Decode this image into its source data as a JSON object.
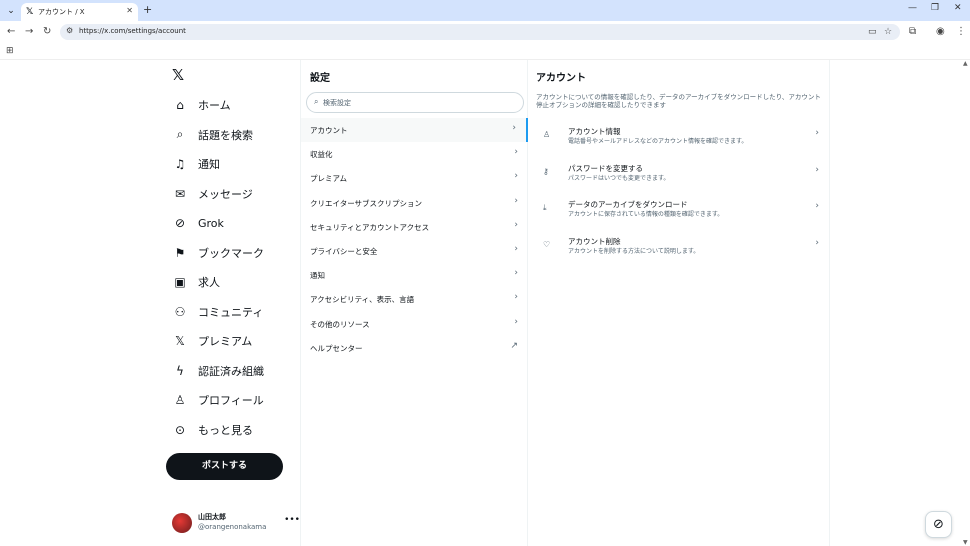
{
  "browser": {
    "tab_title": "アカウント / X",
    "url": "https://x.com/settings/account"
  },
  "leftnav": {
    "items": [
      {
        "label": "ホーム",
        "icon": "home-icon",
        "glyph": "⌂"
      },
      {
        "label": "話題を検索",
        "icon": "search-icon",
        "glyph": "⌕"
      },
      {
        "label": "通知",
        "icon": "bell-icon",
        "glyph": "♫"
      },
      {
        "label": "メッセージ",
        "icon": "envelope-icon",
        "glyph": "✉"
      },
      {
        "label": "Grok",
        "icon": "grok-icon",
        "glyph": "⊘"
      },
      {
        "label": "ブックマーク",
        "icon": "bookmark-icon",
        "glyph": "⚑"
      },
      {
        "label": "求人",
        "icon": "briefcase-icon",
        "glyph": "▣"
      },
      {
        "label": "コミュニティ",
        "icon": "community-icon",
        "glyph": "⚇"
      },
      {
        "label": "プレミアム",
        "icon": "x-icon",
        "glyph": "𝕏"
      },
      {
        "label": "認証済み組織",
        "icon": "lightning-icon",
        "glyph": "ϟ"
      },
      {
        "label": "プロフィール",
        "icon": "person-icon",
        "glyph": "♙"
      },
      {
        "label": "もっと見る",
        "icon": "more-circle-icon",
        "glyph": "⊙"
      }
    ],
    "post_label": "ポストする",
    "user_name": "山田太郎",
    "user_handle": "@orangenonakama"
  },
  "settings": {
    "title": "設定",
    "search_placeholder": "検索設定",
    "items": [
      {
        "label": "アカウント",
        "active": true,
        "glyph": "›"
      },
      {
        "label": "収益化",
        "glyph": "›"
      },
      {
        "label": "プレミアム",
        "glyph": "›"
      },
      {
        "label": "クリエイターサブスクリプション",
        "glyph": "›"
      },
      {
        "label": "セキュリティとアカウントアクセス",
        "glyph": "›"
      },
      {
        "label": "プライバシーと安全",
        "glyph": "›"
      },
      {
        "label": "通知",
        "glyph": "›"
      },
      {
        "label": "アクセシビリティ、表示、言語",
        "glyph": "›"
      },
      {
        "label": "その他のリソース",
        "glyph": "›"
      },
      {
        "label": "ヘルプセンター",
        "glyph": "↗"
      }
    ]
  },
  "account": {
    "title": "アカウント",
    "description": "アカウントについての情報を確認したり、データのアーカイブをダウンロードしたり、アカウント停止オプションの詳細を確認したりできます",
    "items": [
      {
        "label": "アカウント情報",
        "sub": "電話番号やメールアドレスなどのアカウント情報を確認できます。",
        "icon": "person-icon",
        "glyph": "♙"
      },
      {
        "label": "パスワードを変更する",
        "sub": "パスワードはいつでも変更できます。",
        "icon": "key-icon",
        "glyph": "⚷"
      },
      {
        "label": "データのアーカイブをダウンロード",
        "sub": "アカウントに保存されている情報の種類を確認できます。",
        "icon": "download-icon",
        "glyph": "⤓"
      },
      {
        "label": "アカウント削除",
        "sub": "アカウントを削除する方法について説明します。",
        "icon": "broken-heart-icon",
        "glyph": "♡"
      }
    ]
  }
}
